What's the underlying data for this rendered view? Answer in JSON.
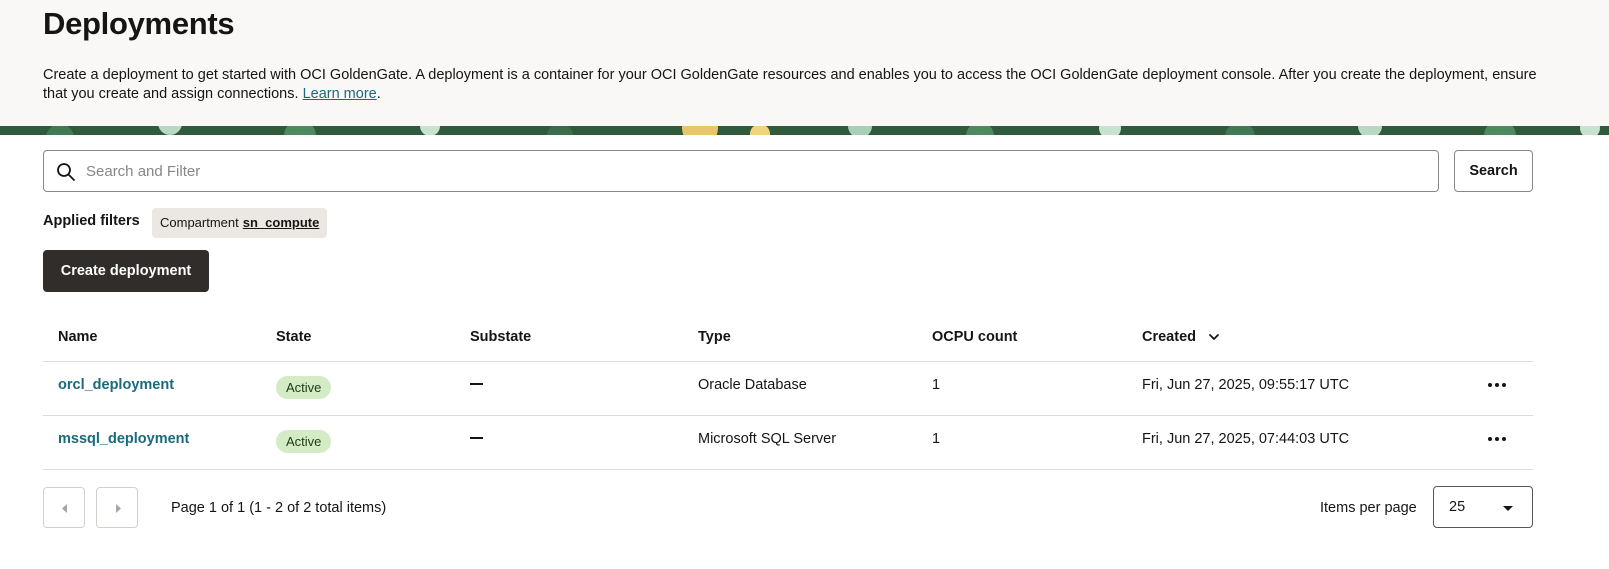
{
  "header": {
    "title": "Deployments",
    "description": "Create a deployment to get started with OCI GoldenGate. A deployment is a container for your OCI GoldenGate resources and enables you to access the OCI GoldenGate deployment console. After you create the deployment, ensure that you create and assign connections.",
    "learn_more": "Learn more",
    "period": "."
  },
  "search": {
    "placeholder": "Search and Filter",
    "button_label": "Search",
    "icon": "search-icon"
  },
  "filters": {
    "label": "Applied filters",
    "chip_key": "Compartment",
    "chip_value": "sn_compute"
  },
  "create_button": "Create deployment",
  "table": {
    "columns": [
      "Name",
      "State",
      "Substate",
      "Type",
      "OCPU count",
      "Created"
    ],
    "sort_icon": "chevron-down-icon",
    "rows": [
      {
        "name": "orcl_deployment",
        "state": "Active",
        "substate": "—",
        "type": "Oracle Database",
        "ocpu": "1",
        "created": "Fri, Jun 27, 2025, 09:55:17 UTC"
      },
      {
        "name": "mssql_deployment",
        "state": "Active",
        "substate": "—",
        "type": "Microsoft SQL Server",
        "ocpu": "1",
        "created": "Fri, Jun 27, 2025, 07:44:03 UTC"
      }
    ]
  },
  "pagination": {
    "page_info": "Page 1 of 1 (1 - 2 of 2 total items)",
    "items_per_page_label": "Items per page",
    "items_per_page_value": "25"
  },
  "colors": {
    "primary_button": "#312d2a",
    "link": "#1a6a7b",
    "active_badge": "#d4ebc5",
    "header_bg": "#f9f8f6"
  }
}
